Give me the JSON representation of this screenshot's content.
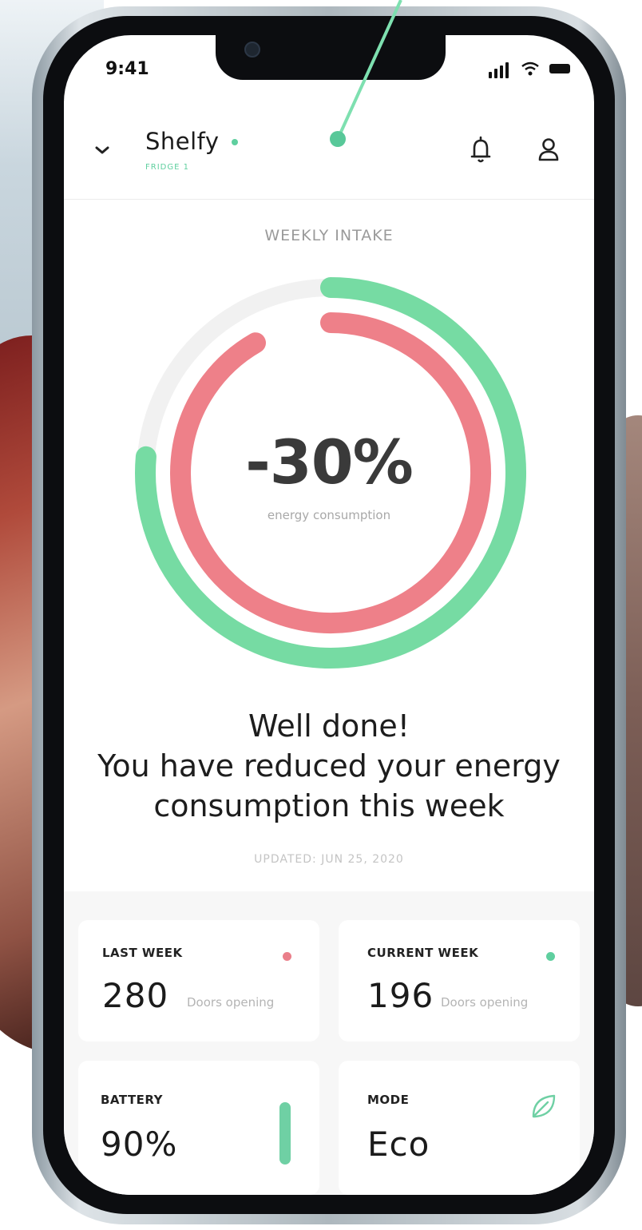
{
  "status_bar": {
    "time": "9:41"
  },
  "header": {
    "title": "Shelfy",
    "subtitle": "FRIDGE 1"
  },
  "intake": {
    "label": "WEEKLY INTAKE",
    "value": "-30%",
    "caption": "energy consumption",
    "message_line1": "Well done!",
    "message_line2": "You have reduced your energy",
    "message_line3": "consumption this week",
    "updated": "UPDATED: JUN 25, 2020"
  },
  "cards": {
    "last_week": {
      "label": "LAST WEEK",
      "value": "280",
      "unit": "Doors opening",
      "color": "#ea7f8a"
    },
    "current_week": {
      "label": "CURRENT WEEK",
      "value": "196",
      "unit": "Doors opening",
      "color": "#5fcf9f"
    },
    "battery": {
      "label": "BATTERY",
      "value": "90%",
      "level": 0.9,
      "color": "#6fd0a4"
    },
    "mode": {
      "label": "MODE",
      "value": "Eco",
      "icon": "leaf-icon"
    }
  },
  "colors": {
    "accent": "#5fcf9f",
    "ring_red": "#ee8089",
    "ring_green": "#76dba3",
    "ring_track": "#f1f1f1"
  }
}
